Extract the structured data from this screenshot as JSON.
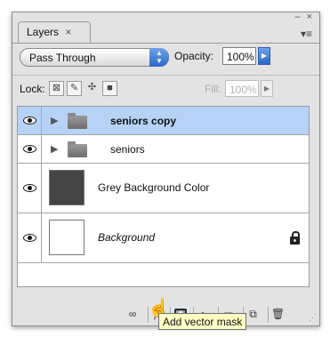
{
  "panel": {
    "tab_label": "Layers",
    "tab_close": "×",
    "window_controls": "– ×",
    "menu_glyph": "▾≡"
  },
  "blend": {
    "mode": "Pass Through"
  },
  "opacity": {
    "label": "Opacity:",
    "value": "100%"
  },
  "lock": {
    "label": "Lock:",
    "icons": [
      "transparency-lock-icon",
      "paint-lock-icon",
      "move-lock-icon",
      "all-lock-icon"
    ]
  },
  "fill": {
    "label": "Fill:",
    "value": "100%"
  },
  "layers": [
    {
      "name": "seniors copy",
      "type": "group",
      "selected": true
    },
    {
      "name": "seniors",
      "type": "group",
      "selected": false
    },
    {
      "name": "Grey Background Color",
      "type": "fill",
      "thumbnail_color": "#454545",
      "selected": false
    },
    {
      "name": "Background",
      "type": "background",
      "thumbnail_color": "#ffffff",
      "locked": true,
      "selected": false
    }
  ],
  "bottom_buttons": [
    "link-layers-icon",
    "fx-icon",
    "add-vector-mask-icon",
    "adjustment-layer-icon",
    "new-group-icon",
    "new-layer-icon",
    "trash-icon"
  ],
  "fx_label": "fx",
  "tooltip": "Add vector mask",
  "colors": {
    "selection": "#b6d2f6",
    "accent_blue": "#2e68c7",
    "tooltip_bg": "#ffffc4"
  }
}
